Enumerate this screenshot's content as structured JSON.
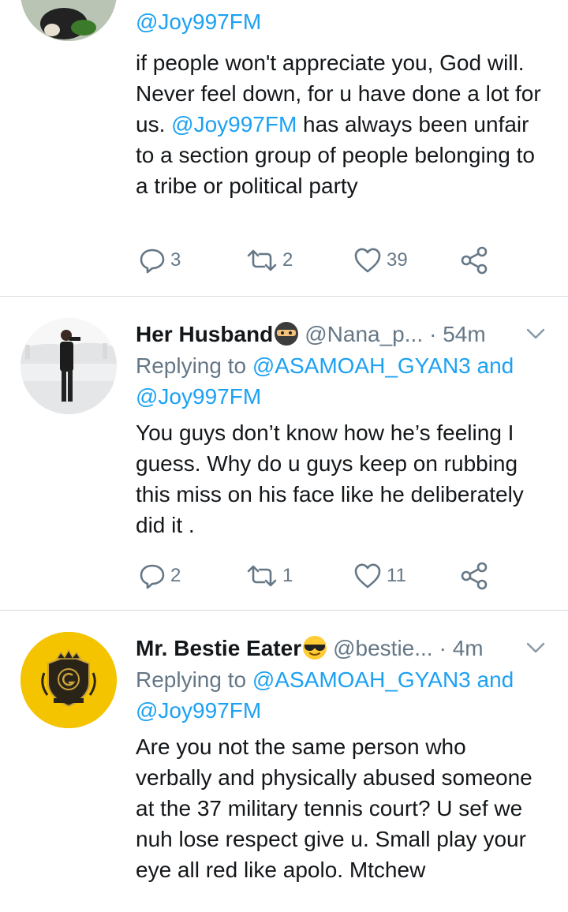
{
  "tweets": [
    {
      "reply_mention_2": "@Joy997FM",
      "text_before": "if people won't appreciate you, God will. Never feel down, for u have done a lot for us. ",
      "text_mention": "@Joy997FM",
      "text_after": " has always been unfair to a section group of people belonging to a tribe or political party",
      "replies": "3",
      "retweets": "2",
      "likes": "39"
    },
    {
      "name": "Her Husband",
      "handle": "@Nana_p...",
      "time": "· 54m",
      "reply_prefix": "Replying to ",
      "reply_mention_1": "@ASAMOAH_GYAN3",
      "reply_and": " and",
      "reply_mention_2": "@Joy997FM",
      "text": "You guys don’t know how he’s feeling I guess. Why do u guys keep on rubbing this miss on his face like he deliberately did it .",
      "replies": "2",
      "retweets": "1",
      "likes": "11"
    },
    {
      "name": "Mr. Bestie Eater",
      "handle": "@bestie...",
      "time": "· 4m",
      "reply_prefix": "Replying to ",
      "reply_mention_1": "@ASAMOAH_GYAN3",
      "reply_and": " and",
      "reply_mention_2": "@Joy997FM",
      "text": "Are you not the same person who verbally and physically abused someone at the 37 military tennis court? U sef we nuh lose respect give u. Small play your eye all red like apolo. Mtchew"
    }
  ],
  "colors": {
    "link": "#1da1f2",
    "secondary_text": "#657786",
    "divider": "#d8dde1",
    "avatar_yellow": "#f5c400"
  },
  "icons": [
    "reply-icon",
    "retweet-icon",
    "like-icon",
    "share-icon",
    "chevron-down-icon",
    "ninja-emoji",
    "sunglasses-emoji"
  ]
}
